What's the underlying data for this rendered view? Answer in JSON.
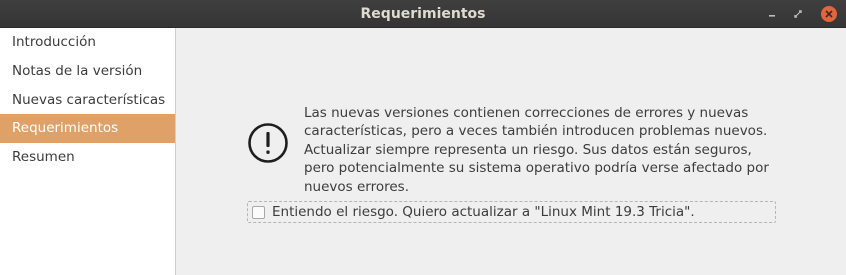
{
  "window": {
    "title": "Requerimientos"
  },
  "sidebar": {
    "items": [
      {
        "label": "Introducción",
        "selected": false
      },
      {
        "label": "Notas de la versión",
        "selected": false
      },
      {
        "label": "Nuevas características",
        "selected": false
      },
      {
        "label": "Requerimientos",
        "selected": true
      },
      {
        "label": "Resumen",
        "selected": false
      }
    ],
    "selected_color": "#e0a168"
  },
  "content": {
    "icon": "warning-exclamation-icon",
    "message_lines": [
      "Las nuevas versiones contienen correcciones de errores y nuevas",
      "características, pero a veces también introducen problemas nuevos.",
      "Actualizar siempre representa un riesgo. Sus datos están seguros,",
      "pero potencialmente su sistema operativo podría verse afectado por",
      "nuevos errores."
    ],
    "checkbox": {
      "label": "Entiendo el riesgo. Quiero actualizar a \"Linux Mint 19.3 Tricia\".",
      "checked": false
    }
  }
}
